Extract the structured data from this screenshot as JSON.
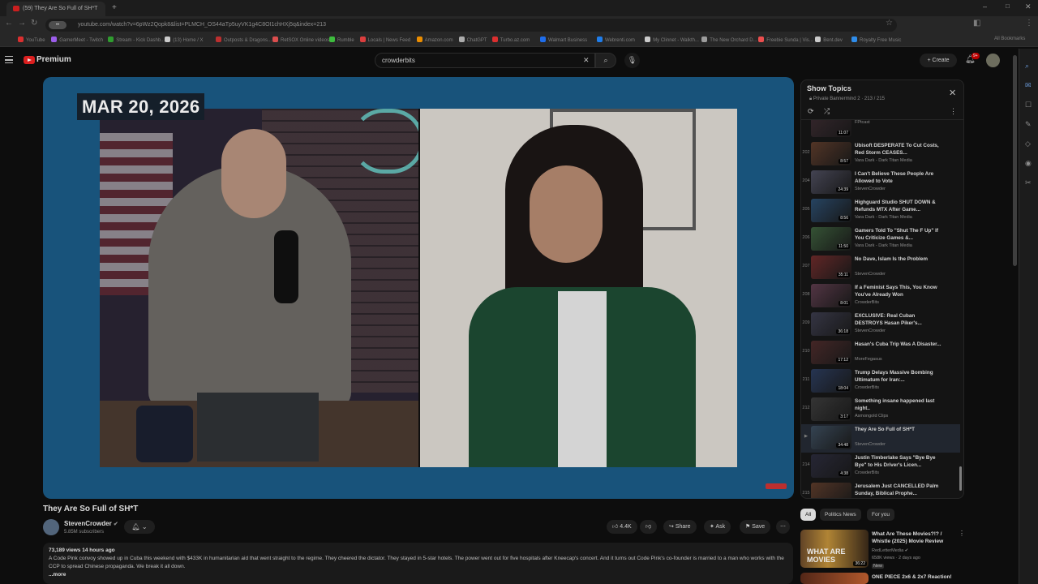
{
  "browser": {
    "tab_title": "(59) They Are So Full of SH*T",
    "url": "youtube.com/watch?v=6pWz2Qopk8&list=PLMCH_OS44aTp5uyVK1g4C8OI1chHXj5q&index=213",
    "verify_label": "••",
    "bookmarks": [
      "YouTube",
      "GamerMeet - Twitch",
      "Stream - Kick Dashb...",
      "(13) Home / X",
      "Outposts & Dragons...",
      "RetSOX Online videos...",
      "Rumble",
      "Locals | News Feed",
      "Amazon.com",
      "ChatGPT",
      "Turbo.az.com",
      "Walmart Business",
      "Webrenti.com",
      "My Clinnet - Walkth...",
      "The New Orchard D...",
      "Freebie Sunda | Vis...",
      "Bent.dev",
      "Royalty Free Music"
    ],
    "all_bookmarks": "All Bookmarks"
  },
  "youtube": {
    "brand": "Premium",
    "search_value": "crowderbits",
    "create_label": "Create",
    "notif_count": "9+"
  },
  "player": {
    "date_badge": "MAR 20, 2026"
  },
  "video": {
    "title": "They Are So Full of SH*T",
    "channel": "StevenCrowder",
    "subscribers": "5.85M subscribers",
    "likes": "4.4K",
    "share": "Share",
    "ask": "Ask",
    "save": "Save",
    "views_time": "73,189 views  14 hours ago",
    "description": "A Code Pink convoy showed up in Cuba this weekend with $433K in humanitarian aid that went straight to the regime. They cheered the dictator. They stayed in 5-star hotels. The power went out for five hospitals after Kneecap's concert. And it turns out Code Pink's co-founder is married to a man who works with the CCP to spread Chinese propaganda. We break it all down.",
    "more": "...more"
  },
  "playlist": {
    "title": "Show Topics",
    "subtitle": "Private Bannermind 2 · 213 / 215",
    "items": [
      {
        "num": "",
        "title": "",
        "channel": "FPtcast",
        "duration": "11:07",
        "color": "#3a2a30"
      },
      {
        "num": "202",
        "title": "Ubisoft DESPERATE To Cut Costs, Red Storm CEASES...",
        "channel": "Vara Dark - Dark Titan Media",
        "duration": "8:57",
        "color": "#5a3a2a"
      },
      {
        "num": "204",
        "title": "I Can't Believe These People Are Allowed to Vote",
        "channel": "StevenCrowder",
        "duration": "24:39",
        "color": "#4a4a5a"
      },
      {
        "num": "205",
        "title": "Highguard Studio SHUT DOWN & Refunds MTX After Game...",
        "channel": "Vara Dark - Dark Titan Media",
        "duration": "8:56",
        "color": "#2a4a6a"
      },
      {
        "num": "206",
        "title": "Gamers Told To \"Shut The F Up\" If You Criticize Games &...",
        "channel": "Vara Dark - Dark Titan Media",
        "duration": "11:50",
        "color": "#3a5a3a"
      },
      {
        "num": "207",
        "title": "No Dave, Islam Is the Problem",
        "channel": "StevenCrowder",
        "duration": "35:11",
        "color": "#6a2a2a"
      },
      {
        "num": "208",
        "title": "If a Feminist Says This, You Know You've Already Won",
        "channel": "CrowderBits",
        "duration": "8:01",
        "color": "#5a3a4a"
      },
      {
        "num": "209",
        "title": "EXCLUSIVE: Real Cuban DESTROYS Hasan Piker's...",
        "channel": "StevenCrowder",
        "duration": "36:18",
        "color": "#3a3a4a"
      },
      {
        "num": "210",
        "title": "Hasan's Cuba Trip Was A Disaster...",
        "channel": "MoreFegasus",
        "duration": "17:12",
        "color": "#4a2a2a"
      },
      {
        "num": "211",
        "title": "Trump Delays Massive Bombing Ultimatum for Iran:...",
        "channel": "CrowderBits",
        "duration": "18:04",
        "color": "#2a3a5a"
      },
      {
        "num": "212",
        "title": "Something insane happened last night..",
        "channel": "Asmongold Clips",
        "duration": "3:17",
        "color": "#3a3a3a"
      },
      {
        "num": "▶",
        "title": "They Are So Full of SH*T",
        "channel": "StevenCrowder",
        "duration": "34:48",
        "color": "#3a4a5a"
      },
      {
        "num": "214",
        "title": "Justin Timberlake Says \"Bye Bye Bye\" to His Driver's Licen...",
        "channel": "CrowderBits",
        "duration": "4:38",
        "color": "#2a2a3a"
      },
      {
        "num": "215",
        "title": "Jerusalem Just CANCELLED Palm Sunday, Biblical Prophe...",
        "channel": "Benny Johnson",
        "duration": "8:17",
        "color": "#5a3a2a"
      }
    ]
  },
  "chips": [
    "All",
    "Politics News",
    "For you"
  ],
  "recommendations": [
    {
      "title": "What Are These Movies?!? / Whistle (2025) Movie Review",
      "channel": "RedLetterMedia",
      "meta": "658K views · 2 days ago",
      "tag": "New",
      "duration": "36:22"
    },
    {
      "title": "ONE PIECE 2x6 & 2x7 Reaction!",
      "channel": "",
      "meta": "",
      "tag": "",
      "duration": ""
    }
  ]
}
